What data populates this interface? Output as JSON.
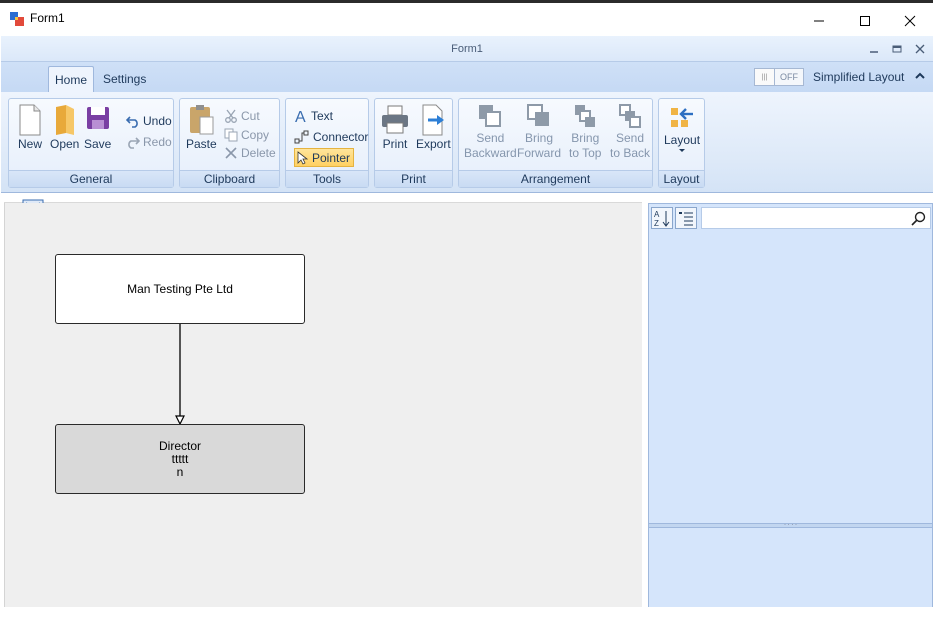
{
  "window": {
    "title": "Form1"
  },
  "form": {
    "title": "Form1"
  },
  "tabs": [
    {
      "label": "Home"
    },
    {
      "label": "Settings"
    }
  ],
  "toggle": {
    "state": "OFF"
  },
  "simplified_layout_label": "Simplified Layout",
  "groups": {
    "general": {
      "label": "General",
      "new": "New",
      "open": "Open",
      "save": "Save",
      "undo": "Undo",
      "redo": "Redo"
    },
    "clipboard": {
      "label": "Clipboard",
      "paste": "Paste",
      "cut": "Cut",
      "copy": "Copy",
      "delete": "Delete"
    },
    "tools": {
      "label": "Tools",
      "text": "Text",
      "connector": "Connector",
      "pointer": "Pointer"
    },
    "print": {
      "label": "Print",
      "print": "Print",
      "export": "Export"
    },
    "arrangement": {
      "label": "Arrangement",
      "send_backward": [
        "Send",
        "Backward"
      ],
      "bring_forward": [
        "Bring",
        "Forward"
      ],
      "bring_to_top": [
        "Bring",
        "to Top"
      ],
      "send_to_back": [
        "Send",
        "to Back"
      ]
    },
    "layout": {
      "label": "Layout",
      "layout": "Layout"
    }
  },
  "diagram": {
    "nodes": [
      {
        "lines": [
          "Man Testing Pte Ltd"
        ],
        "fill": "#ffffff"
      },
      {
        "lines": [
          "Director",
          "ttttt",
          "n"
        ],
        "fill": "#d9d9d9"
      }
    ]
  },
  "property_grid": {
    "search_value": ""
  },
  "colors": {
    "ribbon_bg": "#dde9f8",
    "panel_bg": "#d5e5fb",
    "selected_tool": "#ffd062",
    "save_icon": "#7a3fa3",
    "export_arrow": "#2d7fd6",
    "layout_arrow": "#2d6fc2"
  }
}
